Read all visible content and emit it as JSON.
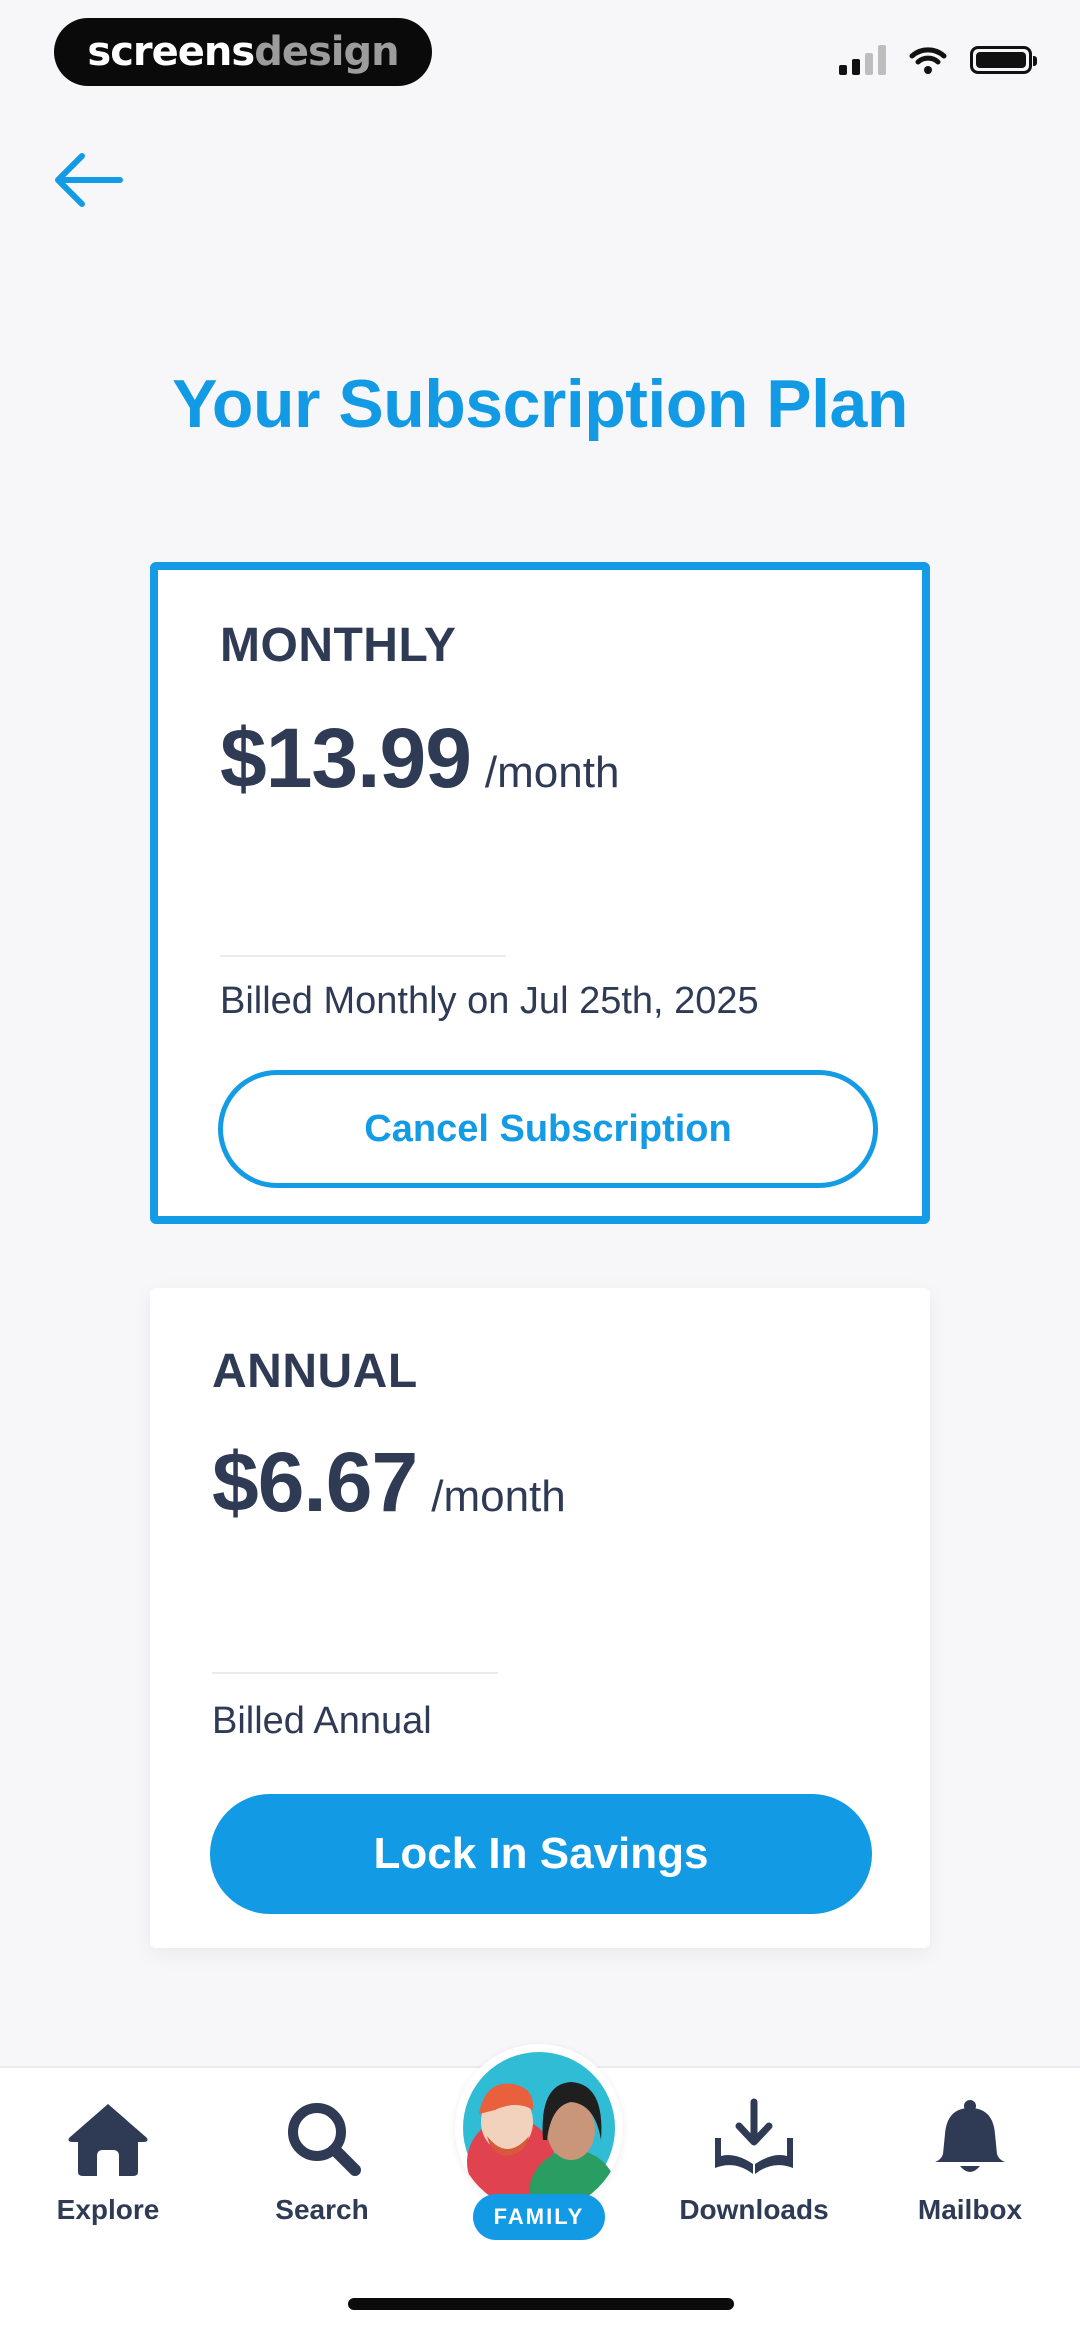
{
  "status_bar": {
    "watermark_part1": "screens",
    "watermark_part2": "design"
  },
  "header": {
    "back_icon": "arrow-left-icon",
    "title": "Your Subscription Plan"
  },
  "plans": [
    {
      "name": "MONTHLY",
      "price": "$13.99",
      "period": "/month",
      "billing": "Billed Monthly on Jul 25th, 2025",
      "action": "Cancel Subscription",
      "selected": true
    },
    {
      "name": "ANNUAL",
      "price": "$6.67",
      "period": "/month",
      "billing": "Billed Annual",
      "action": "Lock In Savings",
      "selected": false
    }
  ],
  "bottom_nav": {
    "items": [
      {
        "label": "Explore",
        "icon": "home-icon"
      },
      {
        "label": "Search",
        "icon": "search-icon"
      },
      {
        "label": "FAMILY",
        "icon": "family-avatar-icon"
      },
      {
        "label": "Downloads",
        "icon": "download-book-icon"
      },
      {
        "label": "Mailbox",
        "icon": "bell-icon"
      }
    ]
  },
  "colors": {
    "accent": "#129ae4",
    "text": "#2f3a55",
    "background": "#f7f7f9"
  }
}
